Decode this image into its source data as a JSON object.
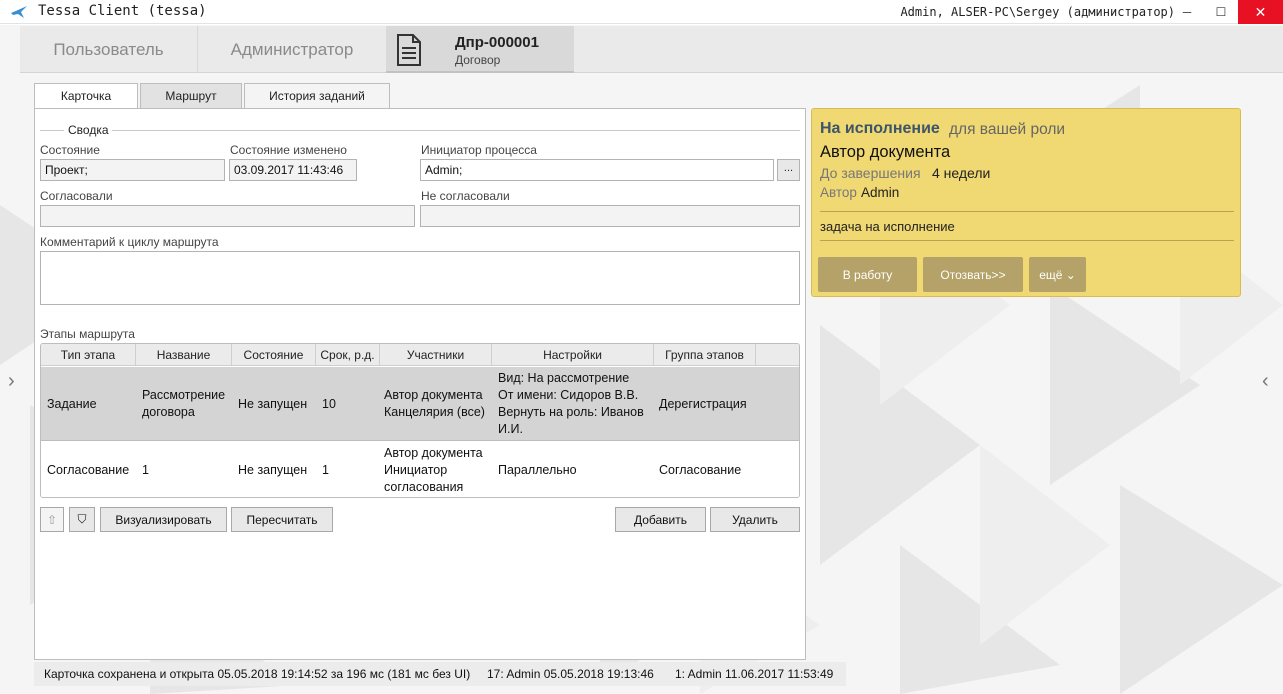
{
  "window": {
    "title": "Tessa Client (tessa)",
    "user_info": "Admin, ALSER-PC\\Sergey (администратор)",
    "minimize": "─",
    "maximize": "☐",
    "close": "✕"
  },
  "top_tabs": {
    "user": "Пользователь",
    "admin": "Администратор",
    "doc_title": "Дпр-000001",
    "doc_subtitle": "Договор"
  },
  "nav": {
    "left": "‹",
    "right": "‹"
  },
  "card_tabs": {
    "card": "Карточка",
    "route": "Маршрут",
    "history": "История заданий"
  },
  "summary": {
    "section_label": "Сводка",
    "state_label": "Состояние",
    "state_value": "Проект;",
    "state_changed_label": "Состояние изменено",
    "state_changed_value": "03.09.2017  11:43:46",
    "initiator_label": "Инициатор процесса",
    "initiator_value": "Admin;",
    "initiator_button": "...",
    "approved_label": "Согласовали",
    "approved_value": "",
    "not_approved_label": "Не согласовали",
    "not_approved_value": "",
    "comment_label": "Комментарий к циклу маршрута",
    "comment_value": ""
  },
  "stages": {
    "label": "Этапы маршрута",
    "columns": [
      "Тип этапа",
      "Название",
      "Состояние",
      "Срок, р.д.",
      "Участники",
      "Настройки",
      "Группа этапов"
    ],
    "rows": [
      {
        "type": "Задание",
        "name": "Рассмотрение\nдоговора",
        "state": "Не запущен",
        "term": "10",
        "participants": "Автор документа\nКанцелярия (все)",
        "settings": "Вид: На рассмотрение\nОт имени: Сидоров В.В.\nВернуть на роль: Иванов\nИ.И.",
        "group": "Дерегистрация"
      },
      {
        "type": "Согласование",
        "name": "1",
        "state": "Не запущен",
        "term": "1",
        "participants": "Автор документа\nИнициатор\nсогласования",
        "settings": "Параллельно",
        "group": "Согласование"
      }
    ]
  },
  "buttons": {
    "up": "⇧",
    "down": "⛉",
    "visualize": "Визуализировать",
    "recalc": "Пересчитать",
    "add": "Добавить",
    "delete": "Удалить"
  },
  "status_bar": {
    "main": "Карточка сохранена и открыта 05.05.2018 19:14:52 за 196 мс (181 мс без UI)",
    "version_17": "17:  Admin  05.05.2018 19:13:46",
    "version_1": "1:  Admin  11.06.2017 11:53:49"
  },
  "task": {
    "status": "На исполнение",
    "role": "для вашей роли",
    "author_doc": "Автор документа",
    "deadline_label": "До завершения",
    "deadline_value": "4 недели",
    "author_label": "Автор",
    "author_value": "Admin",
    "text": "задача на исполнение",
    "btn_work": "В работу",
    "btn_recall": "Отозвать>>",
    "btn_more": "ещё ⌄"
  },
  "colors": {
    "task_bg": "#f0d872",
    "task_button": "#b4a268",
    "task_status": "#3d5569",
    "close_button": "#e81123"
  }
}
